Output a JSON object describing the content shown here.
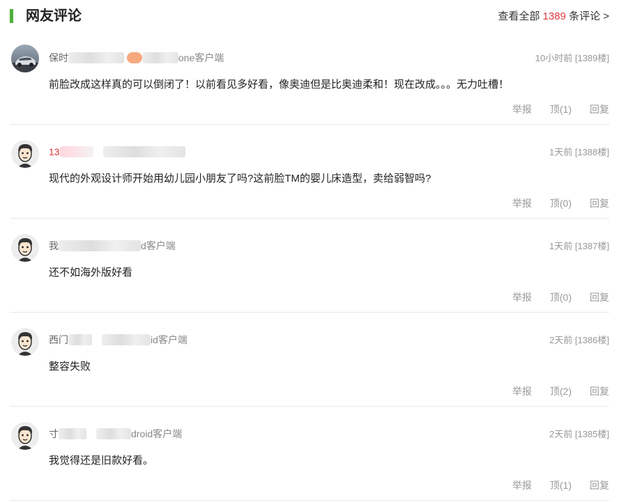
{
  "header": {
    "title": "网友评论",
    "view_all_prefix": "查看全部",
    "view_all_count": "1389",
    "view_all_suffix": "条评论 >"
  },
  "colors": {
    "accent_green": "#4caf3a",
    "count_red": "#e0373f"
  },
  "comments": [
    {
      "avatar_icon": "car-photo-avatar",
      "user_prefix": "保时",
      "user_suffix": "one客户端",
      "time": "10小时前",
      "floor": "[1389楼]",
      "text": "前脸改成这样真的可以倒闭了！以前看见多好看，像奥迪但是比奥迪柔和！现在改成。。。无力吐槽！",
      "report": "举报",
      "like": "顶(1)",
      "reply": "回复"
    },
    {
      "avatar_icon": "cartoon-face-avatar",
      "user_prefix": "13",
      "user_suffix": "",
      "time": "1天前",
      "floor": "[1388楼]",
      "text": "现代的外观设计师开始用幼儿园小朋友了吗?这前脸TM的婴儿床造型，卖给弱智吗?",
      "report": "举报",
      "like": "顶(0)",
      "reply": "回复"
    },
    {
      "avatar_icon": "cartoon-face-avatar",
      "user_prefix": "我",
      "user_suffix": "d客户端",
      "time": "1天前",
      "floor": "[1387楼]",
      "text": "还不如海外版好看",
      "report": "举报",
      "like": "顶(0)",
      "reply": "回复"
    },
    {
      "avatar_icon": "cartoon-face-avatar",
      "user_prefix": "西门",
      "user_suffix": "id客户端",
      "time": "2天前",
      "floor": "[1386楼]",
      "text": "整容失败",
      "report": "举报",
      "like": "顶(2)",
      "reply": "回复"
    },
    {
      "avatar_icon": "cartoon-face-avatar",
      "user_prefix": "寸",
      "user_suffix": "droid客户端",
      "time": "2天前",
      "floor": "[1385楼]",
      "text": "我觉得还是旧款好看。",
      "report": "举报",
      "like": "顶(1)",
      "reply": "回复"
    }
  ]
}
